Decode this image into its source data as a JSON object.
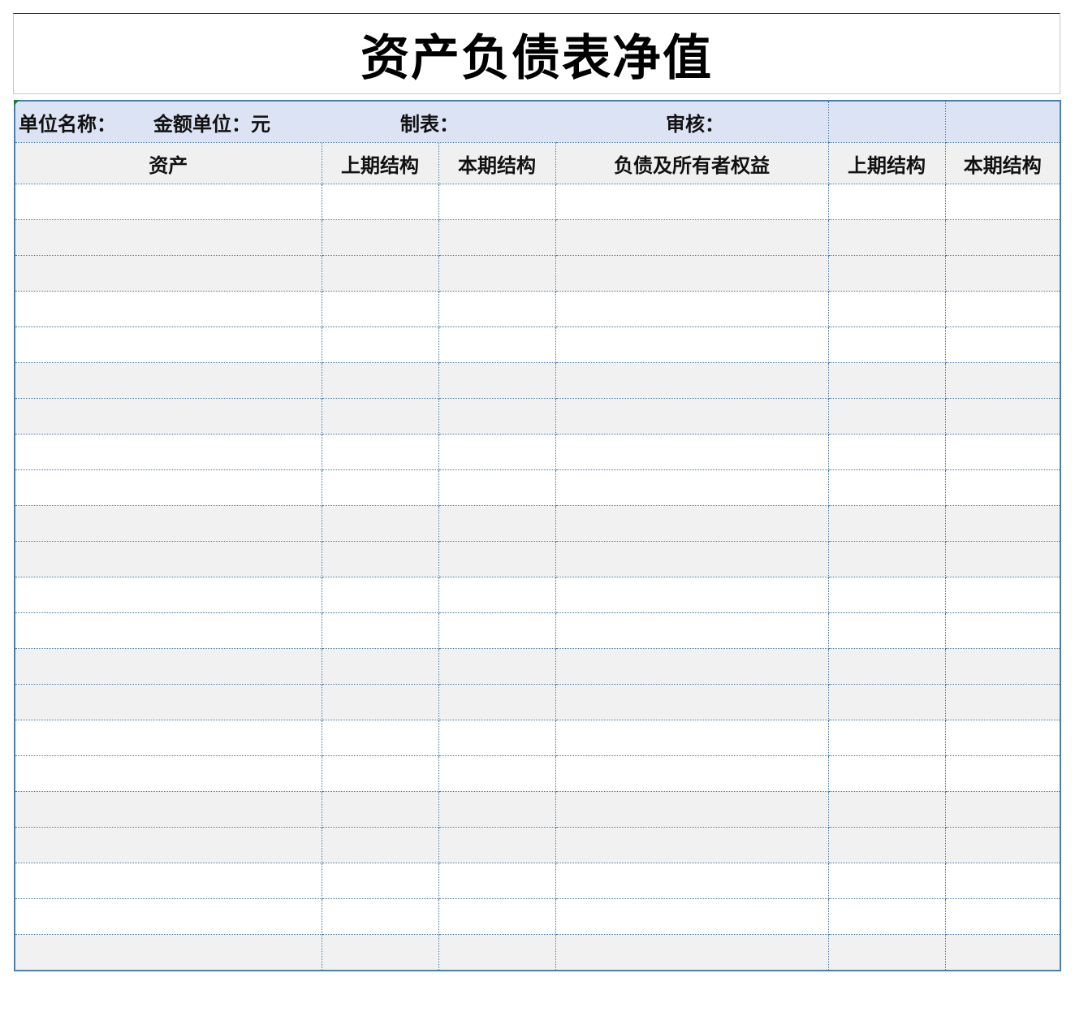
{
  "title": "资产负债表净值",
  "info": {
    "unit_name_label": "单位名称：",
    "amount_unit_label": "金额单位：元",
    "prepared_by_label": "制表：",
    "reviewed_by_label": "审核："
  },
  "columns": [
    "资产",
    "上期结构",
    "本期结构",
    "负债及所有者权益",
    "上期结构",
    "本期结构"
  ],
  "colors": {
    "info_bg": "#dbe3f4",
    "header_bg": "#f0f0f0",
    "band_bg": "#f1f1f1",
    "grid_line": "#3f74a6"
  }
}
